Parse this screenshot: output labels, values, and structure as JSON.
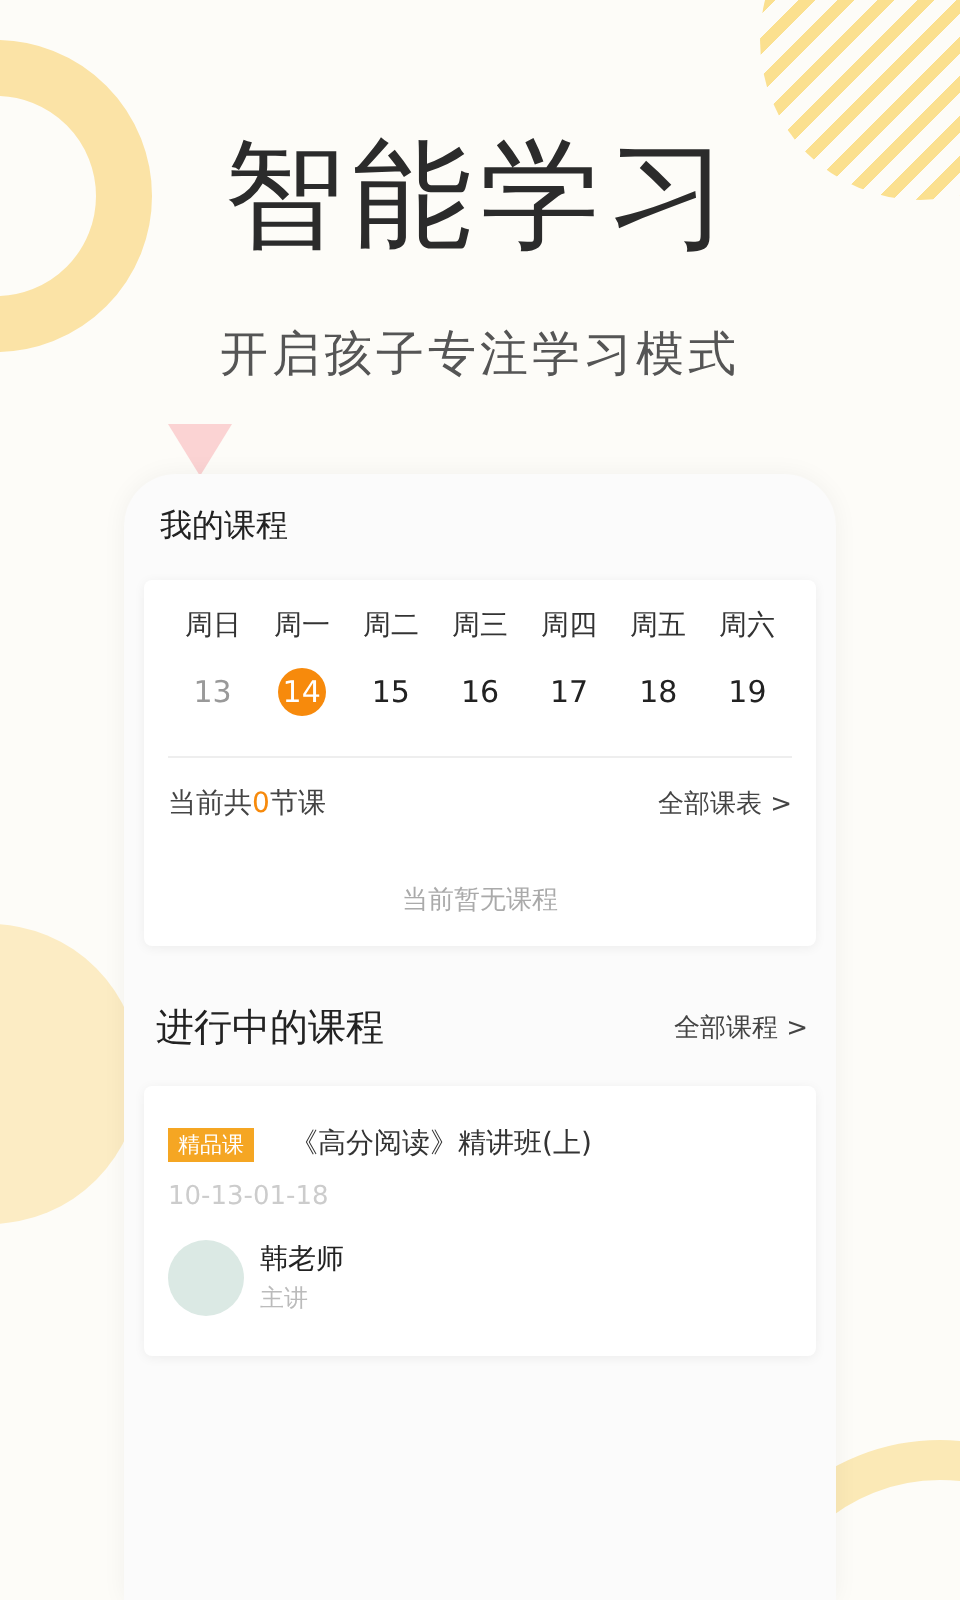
{
  "headline": "智能学习",
  "subtitle": "开启孩子专注学习模式",
  "my_courses": {
    "title": "我的课程",
    "days": [
      {
        "weekday": "周日",
        "date": "13",
        "selected": false,
        "past": true
      },
      {
        "weekday": "周一",
        "date": "14",
        "selected": true,
        "past": false
      },
      {
        "weekday": "周二",
        "date": "15",
        "selected": false,
        "past": false
      },
      {
        "weekday": "周三",
        "date": "16",
        "selected": false,
        "past": false
      },
      {
        "weekday": "周四",
        "date": "17",
        "selected": false,
        "past": false
      },
      {
        "weekday": "周五",
        "date": "18",
        "selected": false,
        "past": false
      },
      {
        "weekday": "周六",
        "date": "19",
        "selected": false,
        "past": false
      }
    ],
    "count": {
      "prefix": "当前共",
      "value": "0",
      "suffix": "节课"
    },
    "all_schedule_link": "全部课表 >",
    "empty_message": "当前暂无课程"
  },
  "in_progress": {
    "title": "进行中的课程",
    "all_link": "全部课程 >",
    "courses": [
      {
        "tag": "精品课",
        "name": "《高分阅读》精讲班(上)",
        "dates": "10-13-01-18",
        "teacher": "韩老师",
        "role": "主讲"
      }
    ]
  }
}
